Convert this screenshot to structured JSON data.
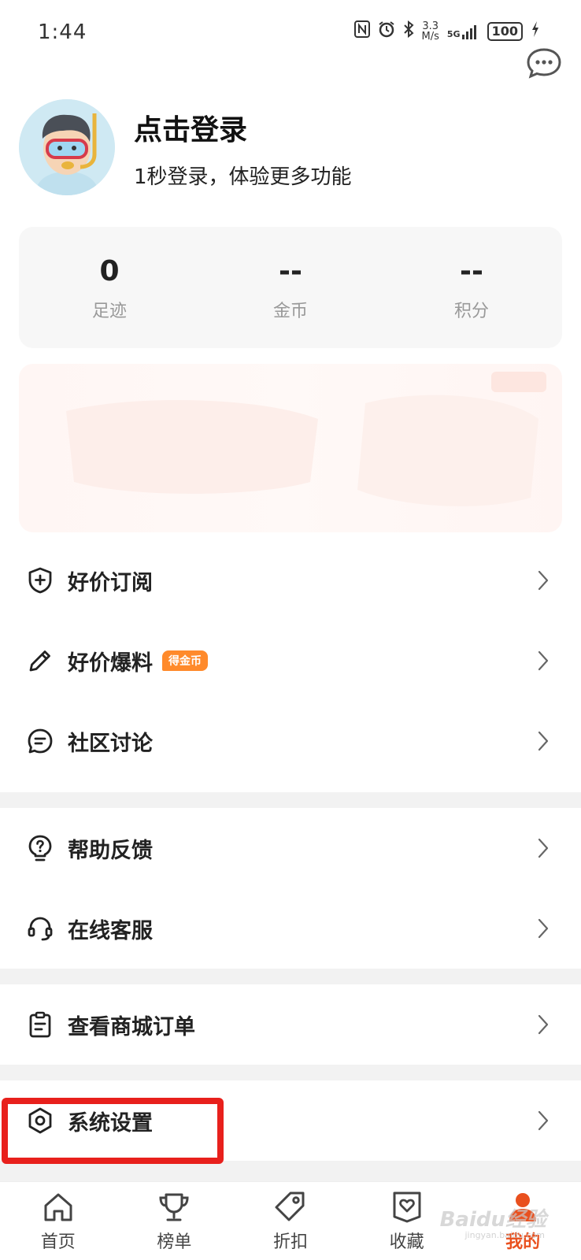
{
  "status_bar": {
    "time": "1:44",
    "net_speed_value": "3.3",
    "net_speed_unit": "M/s",
    "signal": "5G",
    "battery": "100"
  },
  "profile": {
    "title": "点击登录",
    "subtitle": "1秒登录，体验更多功能"
  },
  "stats": [
    {
      "value": "0",
      "label": "足迹"
    },
    {
      "value": "--",
      "label": "金币"
    },
    {
      "value": "--",
      "label": "积分"
    }
  ],
  "menu": {
    "group1": [
      {
        "label": "好价订阅",
        "icon": "shield-plus-icon"
      },
      {
        "label": "好价爆料",
        "icon": "pencil-icon",
        "badge": "得金币"
      },
      {
        "label": "社区讨论",
        "icon": "chat-bubble-icon"
      }
    ],
    "group2": [
      {
        "label": "帮助反馈",
        "icon": "help-bulb-icon"
      },
      {
        "label": "在线客服",
        "icon": "headset-icon"
      }
    ],
    "group3": [
      {
        "label": "查看商城订单",
        "icon": "clipboard-icon"
      }
    ],
    "group4": [
      {
        "label": "系统设置",
        "icon": "settings-hexagon-icon"
      }
    ]
  },
  "tabbar": [
    {
      "label": "首页",
      "icon": "home-icon"
    },
    {
      "label": "榜单",
      "icon": "trophy-icon"
    },
    {
      "label": "折扣",
      "icon": "tag-icon"
    },
    {
      "label": "收藏",
      "icon": "heart-box-icon"
    },
    {
      "label": "我的",
      "icon": "user-icon",
      "active": true
    }
  ],
  "colors": {
    "accent": "#e9501e",
    "badge": "#ff8a2b",
    "highlight": "#e8201c",
    "divider": "#f2f2f2"
  },
  "watermark": {
    "text": "Baidu经验",
    "url_text": "jingyan.baidu.com"
  }
}
